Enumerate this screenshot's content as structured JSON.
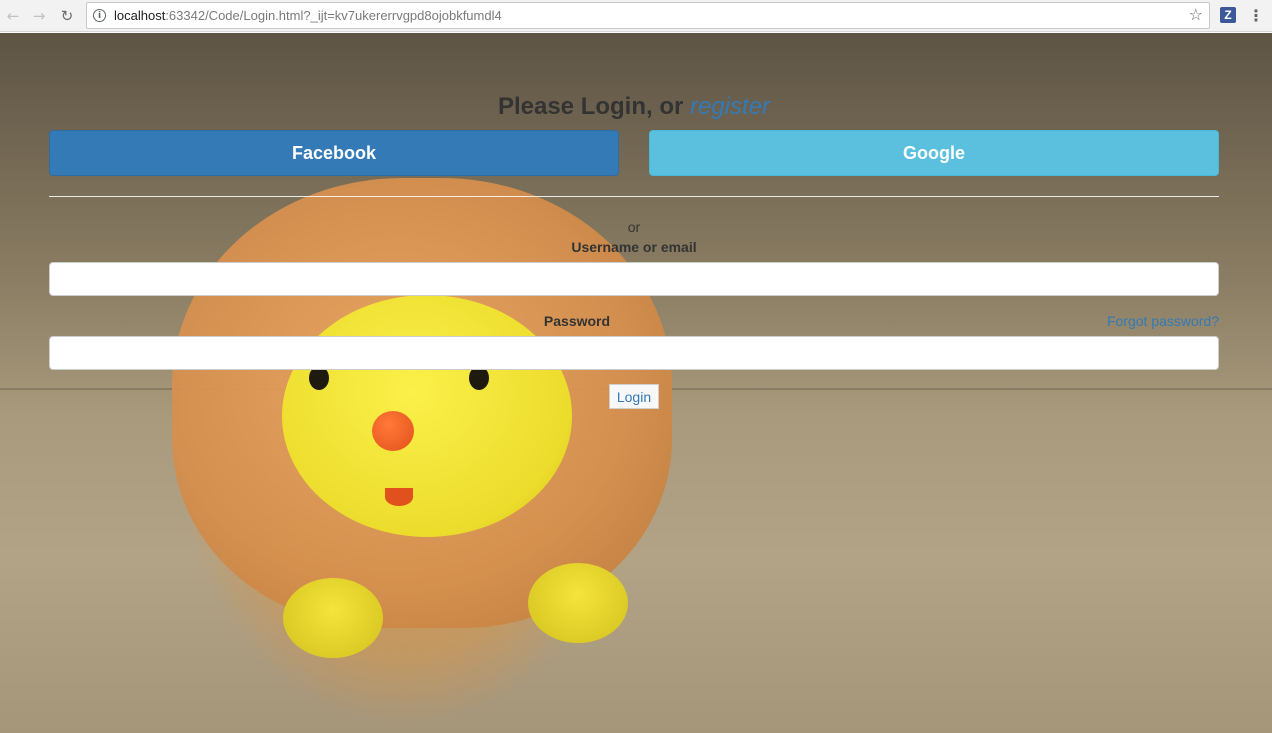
{
  "browser": {
    "url_host": "localhost",
    "url_rest": ":63342/Code/Login.html?_ijt=kv7ukererrvgpd8ojobkfumdl4",
    "extension_letter": "Z"
  },
  "login": {
    "heading_prefix": "Please Login, or ",
    "register_link": "register",
    "facebook_label": "Facebook",
    "google_label": "Google",
    "or_text": "or",
    "username_label": "Username or email",
    "username_value": "",
    "password_label": "Password",
    "password_value": "",
    "forgot_link": "Forgot password?",
    "login_button": "Login"
  },
  "colors": {
    "facebook": "#337ab7",
    "google": "#5bc0de",
    "link": "#337ab7"
  },
  "icons": [
    "back-arrow-icon",
    "forward-arrow-icon",
    "reload-icon",
    "info-icon",
    "star-icon",
    "extension-icon",
    "menu-icon"
  ]
}
